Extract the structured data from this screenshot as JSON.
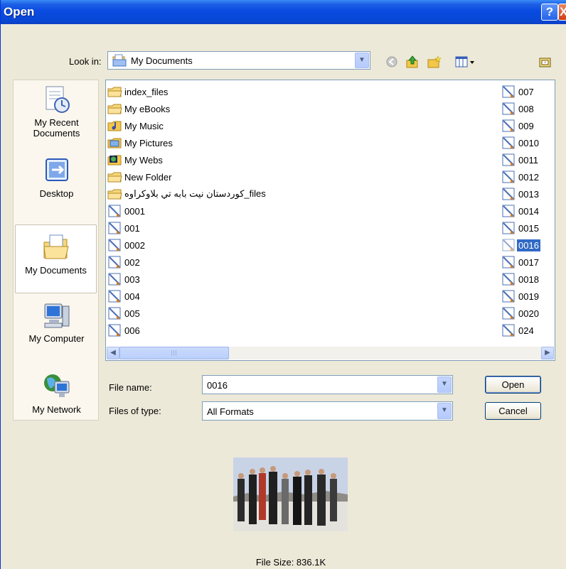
{
  "window": {
    "title": "Open",
    "help_symbol": "?",
    "close_symbol": "X"
  },
  "look_in": {
    "label": "Look in:",
    "value": "My Documents",
    "icons": [
      "back-icon",
      "up-folder-icon",
      "new-folder-icon",
      "views-icon",
      "desktop-folder-icon"
    ]
  },
  "places": [
    {
      "label": "My Recent Documents",
      "icon": "recent-documents-icon"
    },
    {
      "label": "Desktop",
      "icon": "desktop-icon"
    },
    {
      "label": "My Documents",
      "icon": "my-documents-icon",
      "selected": true
    },
    {
      "label": "My Computer",
      "icon": "my-computer-icon"
    },
    {
      "label": "My Network",
      "icon": "my-network-icon"
    }
  ],
  "files_col1": [
    {
      "name": "index_files",
      "icon": "folder-icon"
    },
    {
      "name": "My eBooks",
      "icon": "folder-icon"
    },
    {
      "name": "My Music",
      "icon": "music-folder-icon"
    },
    {
      "name": "My Pictures",
      "icon": "pictures-folder-icon"
    },
    {
      "name": "My Webs",
      "icon": "webs-folder-icon"
    },
    {
      "name": "New Folder",
      "icon": "folder-icon"
    },
    {
      "name": "کوردستان نيت بابه تي بلاوكراوه_files",
      "icon": "folder-icon"
    },
    {
      "name": "0001",
      "icon": "image-file-icon"
    },
    {
      "name": "001",
      "icon": "image-file-icon"
    },
    {
      "name": "0002",
      "icon": "image-file-icon"
    },
    {
      "name": "002",
      "icon": "image-file-icon"
    },
    {
      "name": "003",
      "icon": "image-file-icon"
    },
    {
      "name": "004",
      "icon": "image-file-icon"
    },
    {
      "name": "005",
      "icon": "image-file-icon"
    },
    {
      "name": "006",
      "icon": "image-file-icon"
    }
  ],
  "files_col2": [
    {
      "name": "007",
      "icon": "image-file-icon"
    },
    {
      "name": "008",
      "icon": "image-file-icon"
    },
    {
      "name": "009",
      "icon": "image-file-icon"
    },
    {
      "name": "0010",
      "icon": "image-file-icon"
    },
    {
      "name": "0011",
      "icon": "image-file-icon"
    },
    {
      "name": "0012",
      "icon": "image-file-icon"
    },
    {
      "name": "0013",
      "icon": "image-file-icon"
    },
    {
      "name": "0014",
      "icon": "image-file-icon"
    },
    {
      "name": "0015",
      "icon": "image-file-icon"
    },
    {
      "name": "0016",
      "icon": "image-file-icon",
      "selected": true
    },
    {
      "name": "0017",
      "icon": "image-file-icon"
    },
    {
      "name": "0018",
      "icon": "image-file-icon"
    },
    {
      "name": "0019",
      "icon": "image-file-icon"
    },
    {
      "name": "0020",
      "icon": "image-file-icon"
    },
    {
      "name": "024",
      "icon": "image-file-icon"
    }
  ],
  "file_name": {
    "label": "File name:",
    "value": "0016"
  },
  "file_type": {
    "label": "Files of type:",
    "value": "All Formats"
  },
  "buttons": {
    "open": "Open",
    "cancel": "Cancel"
  },
  "preview": {
    "icon": "photo-preview",
    "file_size": "File Size: 836.1K"
  },
  "colors": {
    "titlebar": "#0a4be0",
    "selection": "#316ac5",
    "dialog_bg": "#ece9d8"
  }
}
